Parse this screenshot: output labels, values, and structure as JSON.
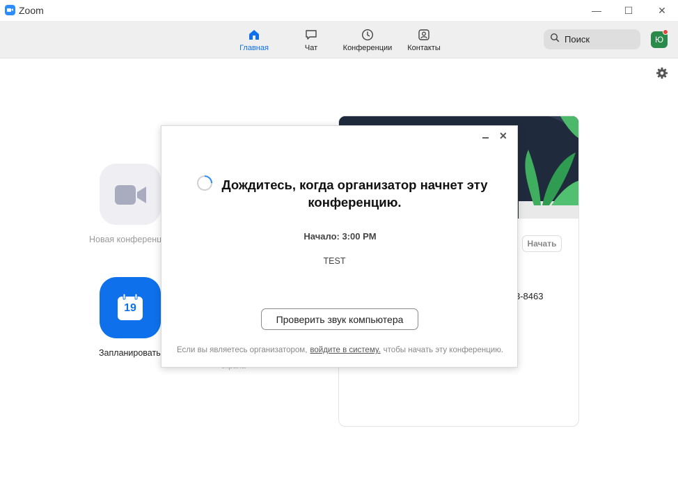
{
  "window": {
    "title": "Zoom",
    "minimize_glyph": "—",
    "maximize_glyph": "☐",
    "close_glyph": "✕"
  },
  "nav": {
    "items": [
      {
        "label": "Главная",
        "icon": "home-icon",
        "active": true
      },
      {
        "label": "Чат",
        "icon": "chat-icon",
        "active": false
      },
      {
        "label": "Конференции",
        "icon": "clock-icon",
        "active": false
      },
      {
        "label": "Контакты",
        "icon": "contacts-icon",
        "active": false
      }
    ],
    "search_label": "Поиск",
    "avatar_initial": "Ю"
  },
  "home": {
    "new_meeting_label": "Новая конференция",
    "schedule_label": "Запланировать",
    "ghost_label": "экрана",
    "calendar_day": "19"
  },
  "panel": {
    "start_button": "Начать",
    "number_fragment": "3-8463"
  },
  "dialog": {
    "title": "Дождитесь, когда организатор начнет эту конференцию.",
    "start_time": "Начало: 3:00 PM",
    "topic": "TEST",
    "test_audio_button": "Проверить звук компьютера",
    "footer_prefix": "Если вы являетесь организатором,",
    "footer_link": "войдите в систему.",
    "footer_suffix": "чтобы начать эту конференцию.",
    "close_glyph": "✕"
  },
  "colors": {
    "accent": "#0e71eb",
    "nav_bg": "#efefef",
    "avatar_bg": "#2a8a4a",
    "notification": "#e8433a",
    "banner_bg": "#1f2b3c"
  }
}
